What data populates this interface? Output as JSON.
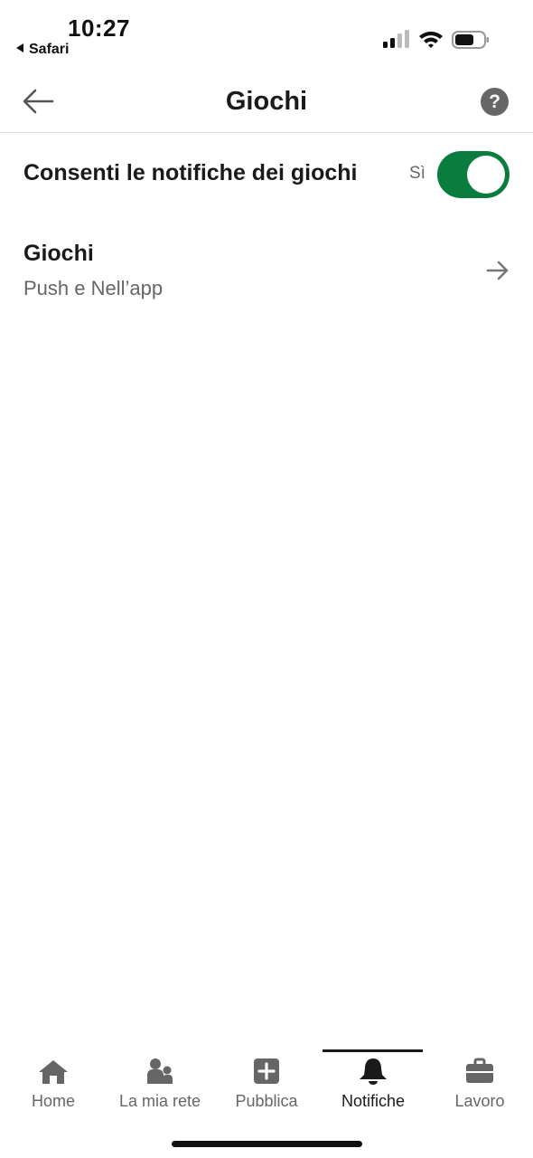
{
  "status_bar": {
    "time": "10:27",
    "back_app": "Safari"
  },
  "header": {
    "title": "Giochi",
    "back_icon": "arrow-left-icon",
    "help_icon": "question-circle-icon",
    "help_glyph": "?"
  },
  "settings": {
    "toggle_label": "Consenti le notifiche dei giochi",
    "toggle_state_text": "Sì",
    "toggle_on": true,
    "accent_color": "#0a7c3e"
  },
  "nav_item": {
    "title": "Giochi",
    "subtitle": "Push e Nell’app",
    "icon": "arrow-right-icon"
  },
  "tabbar": {
    "active_index": 3,
    "items": [
      {
        "label": "Home",
        "icon": "home-icon"
      },
      {
        "label": "La mia rete",
        "icon": "people-icon"
      },
      {
        "label": "Pubblica",
        "icon": "plus-square-icon"
      },
      {
        "label": "Notifiche",
        "icon": "bell-icon"
      },
      {
        "label": "Lavoro",
        "icon": "briefcase-icon"
      }
    ]
  }
}
